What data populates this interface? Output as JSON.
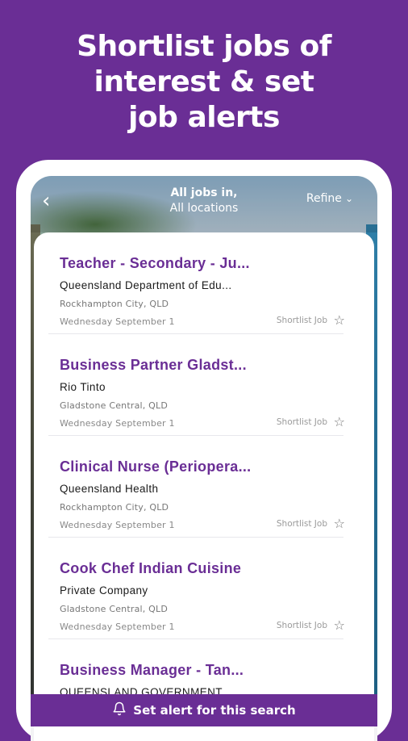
{
  "headline": [
    "Shortlist jobs of",
    "interest & set",
    "job alerts"
  ],
  "header": {
    "back_icon": "chevron-left-icon",
    "title_line1": "All jobs in,",
    "title_line2": "All locations",
    "refine_label": "Refine",
    "refine_icon": "chevron-down-icon"
  },
  "jobs": [
    {
      "title": "Teacher - Secondary - Ju...",
      "company": "Queensland Department of Edu...",
      "location": "Rockhampton City, QLD",
      "date": "Wednesday September 1",
      "shortlist": "Shortlist Job"
    },
    {
      "title": "Business Partner Gladst...",
      "company": "Rio Tinto",
      "location": "Gladstone Central, QLD",
      "date": "Wednesday September 1",
      "shortlist": "Shortlist Job"
    },
    {
      "title": "Clinical Nurse (Periopera...",
      "company": "Queensland Health",
      "location": "Rockhampton City, QLD",
      "date": "Wednesday September 1",
      "shortlist": "Shortlist Job"
    },
    {
      "title": "Cook Chef Indian Cuisine",
      "company": "Private Company",
      "location": "Gladstone Central, QLD",
      "date": "Wednesday September 1",
      "shortlist": "Shortlist Job"
    },
    {
      "title": "Business Manager - Tan...",
      "company": "QUEENSLAND GOVERNMENT",
      "location": "",
      "date": "",
      "shortlist": ""
    }
  ],
  "alert": {
    "label": "Set alert for this search",
    "icon": "bell-icon"
  },
  "colors": {
    "brand": "#6a2e95",
    "background": "#6a2e95"
  }
}
